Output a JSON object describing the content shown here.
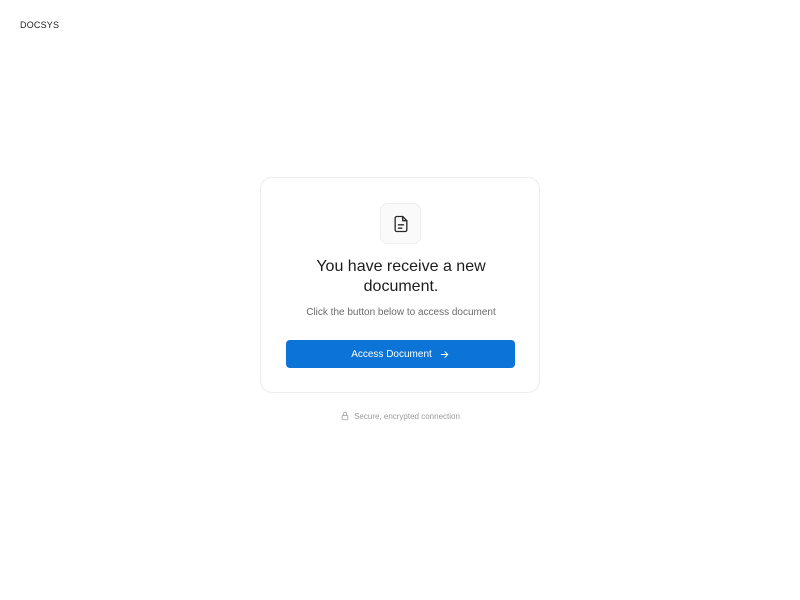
{
  "header": {
    "brand": "DOCSYS"
  },
  "card": {
    "icon": "document-icon",
    "title": "You have receive a new document.",
    "subtitle": "Click the button below to access document",
    "button": {
      "label": "Access Document",
      "icon": "arrow-right-icon"
    }
  },
  "footer": {
    "icon": "lock-icon",
    "note": "Secure, encrypted connection"
  },
  "colors": {
    "accent": "#0b74d6",
    "card_border": "#ececec",
    "muted_text": "#6b6b6b"
  }
}
